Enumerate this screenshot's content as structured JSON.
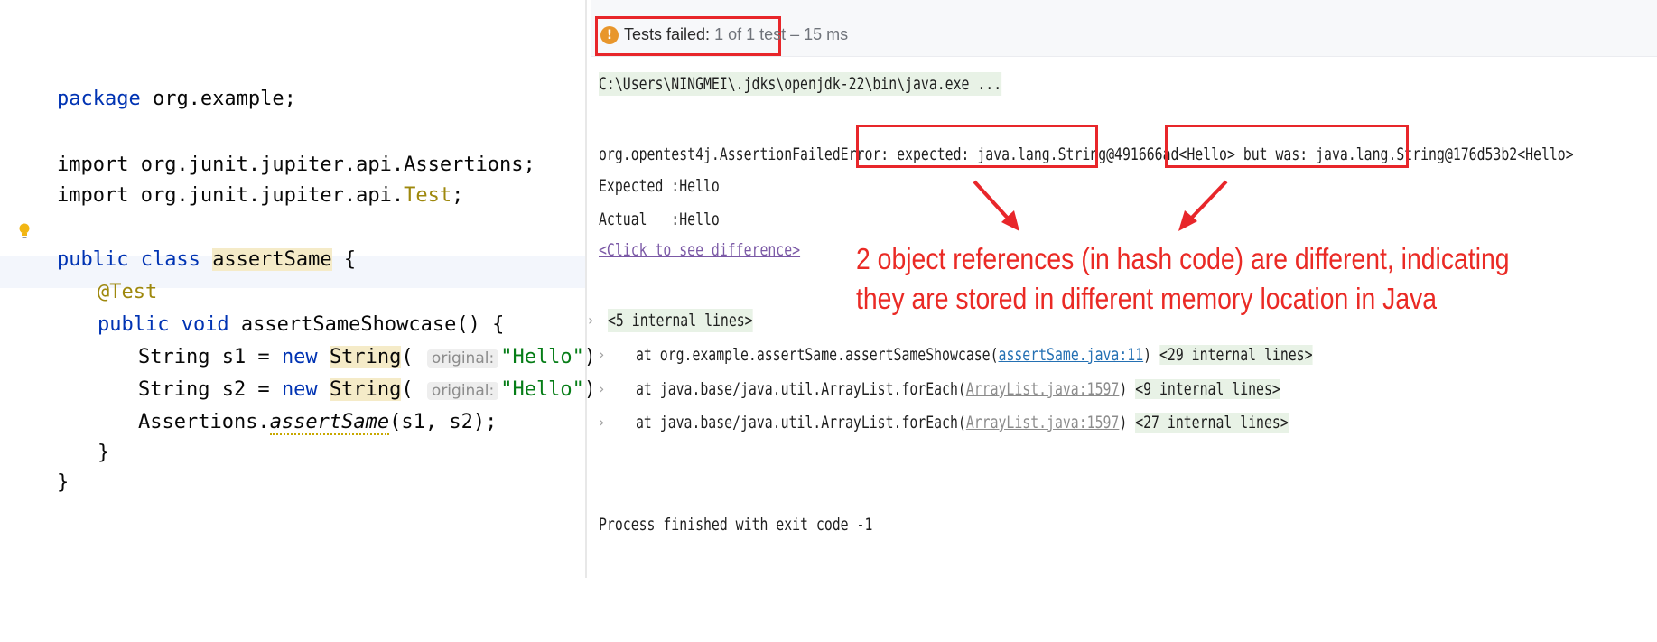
{
  "editor": {
    "lines": {
      "package": "package org.example;",
      "import1": "import org.junit.jupiter.api.Assertions;",
      "import2_pre": "import org.junit.jupiter.api.",
      "import2_cls": "Test",
      "class_kw": "public class",
      "class_name": "assertSame",
      "class_brace": " {",
      "annotation": "@Test",
      "method_kw": "public void",
      "method_sig": " assertSameShowcase() {",
      "s1_decl": "String s1 = ",
      "s2_decl": "String s2 = ",
      "new_kw": "new",
      "string_ctor": "String",
      "paren_open": "(",
      "hint_label": "original:",
      "hello": "\"Hello\"",
      "stmt_end": ");",
      "assert_cls": "Assertions.",
      "assert_method": "assertSame",
      "assert_args": "(s1, s2);",
      "close_method": "}",
      "close_class": "}"
    }
  },
  "console": {
    "status": {
      "label": "Tests failed:",
      "detail": "1 of 1 test – 15 ms"
    },
    "command": "C:\\Users\\NINGMEI\\.jdks\\openjdk-22\\bin\\java.exe ...",
    "error_prefix": "org.opentest4j.AssertionFailedError: expected:",
    "expected_value": "java.lang.String@491666ad<Hello>",
    "but_was": "but was:",
    "actual_value": "java.lang.String@176d53b2<Hello>",
    "expected_line": "Expected :Hello",
    "actual_line": "Actual   :Hello",
    "diff_link": "<Click to see difference>",
    "internal_5": "<5 internal lines>",
    "stack": [
      {
        "prefix": "at org.example.assertSame.assertSameShowcase(",
        "link": "assertSame.java:11",
        "suffix": ")",
        "internal": "<29 internal lines>"
      },
      {
        "prefix": "at java.base/java.util.ArrayList.forEach(",
        "link": "ArrayList.java:1597",
        "suffix": ")",
        "internal": "<9 internal lines>"
      },
      {
        "prefix": "at java.base/java.util.ArrayList.forEach(",
        "link": "ArrayList.java:1597",
        "suffix": ")",
        "internal": "<27 internal lines>"
      }
    ],
    "exit": "Process finished with exit code -1"
  },
  "annotation": {
    "line1": "2 object references (in hash code) are different, indicating",
    "line2": "they are stored in different memory location in Java",
    "color": "#ea2a25"
  },
  "icons": [
    "bulb-icon",
    "fail-icon",
    "chevron-right-icon",
    "arrow-icon"
  ]
}
